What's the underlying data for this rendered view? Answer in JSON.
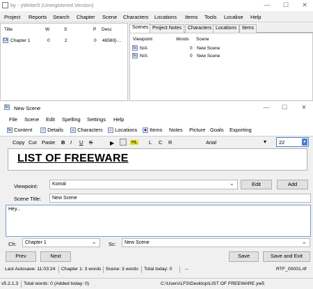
{
  "window": {
    "title": "by - yWriter5 (Unregistered Version)",
    "minimize": "—",
    "maximize": "☐",
    "close": "✕"
  },
  "menu": [
    "Project",
    "Reports",
    "Search",
    "Chapter",
    "Scene",
    "Characters",
    "Locations",
    "Items",
    "Tools",
    "Localise",
    "Help"
  ],
  "chapters": {
    "columns": [
      "Title",
      "W",
      "S",
      "P",
      "Desc"
    ],
    "rows": [
      {
        "title": "Chapter 1",
        "w": "0",
        "s": "2",
        "p": "0",
        "desc": "46580[-..."
      }
    ]
  },
  "right_tabs": [
    "Scenes",
    "Project Notes",
    "Characters",
    "Locations",
    "Items"
  ],
  "scenes": {
    "columns": [
      "Viewpoint",
      "Words",
      "Scene"
    ],
    "rows": [
      {
        "viewpoint": "N/A",
        "words": "0",
        "scene": "New Scene"
      },
      {
        "viewpoint": "N/A",
        "words": "0",
        "scene": "New Scene"
      }
    ]
  },
  "dialog": {
    "title": "New Scene",
    "minimize": "—",
    "maximize": "☐",
    "close": "✕",
    "menu": [
      "File",
      "Scene",
      "Edit",
      "Spelling",
      "Settings",
      "Help"
    ],
    "tabs": [
      "Content",
      "Details",
      "Characters",
      "Locations",
      "Items",
      "Notes",
      "Picture",
      "Goals",
      "Exporting"
    ],
    "toolbar": {
      "copy": "Copy",
      "cut": "Cut",
      "paste": "Paste",
      "bold": "B",
      "italic": "I",
      "underline": "U",
      "strike": "S",
      "hl": "HL",
      "left": "L",
      "center": "C",
      "right": "R",
      "font": "Arial",
      "size": "22"
    },
    "heading_text": "LIST OF FREEWARE",
    "viewpoint_label": "Viewpoint:",
    "viewpoint_value": "Komal",
    "edit_button": "Edit",
    "add_button": "Add",
    "scene_title_label": "Scene Title:",
    "scene_title_value": "New Scene",
    "body_text": "Hey...",
    "ch_label": "Ch:",
    "ch_value": "Chapter 1",
    "sc_label": "Sc:",
    "sc_value": "New Scene",
    "prev": "Prev",
    "next": "Next",
    "save": "Save",
    "save_exit": "Save and Exit",
    "status": [
      "Last Autosave: 11:03:24",
      "Chapter 1: 3 words",
      "Scene: 3 words",
      "Total today: 0",
      "--"
    ],
    "rtf_file": "RTF_00001.rtf"
  },
  "statusbar": {
    "version": "v5.2.1.3",
    "total": "Total words: 0 (Added today: 0)",
    "path": "C:\\Users\\LFS\\Desktop\\LIST OF FREEWARE.yw5"
  }
}
